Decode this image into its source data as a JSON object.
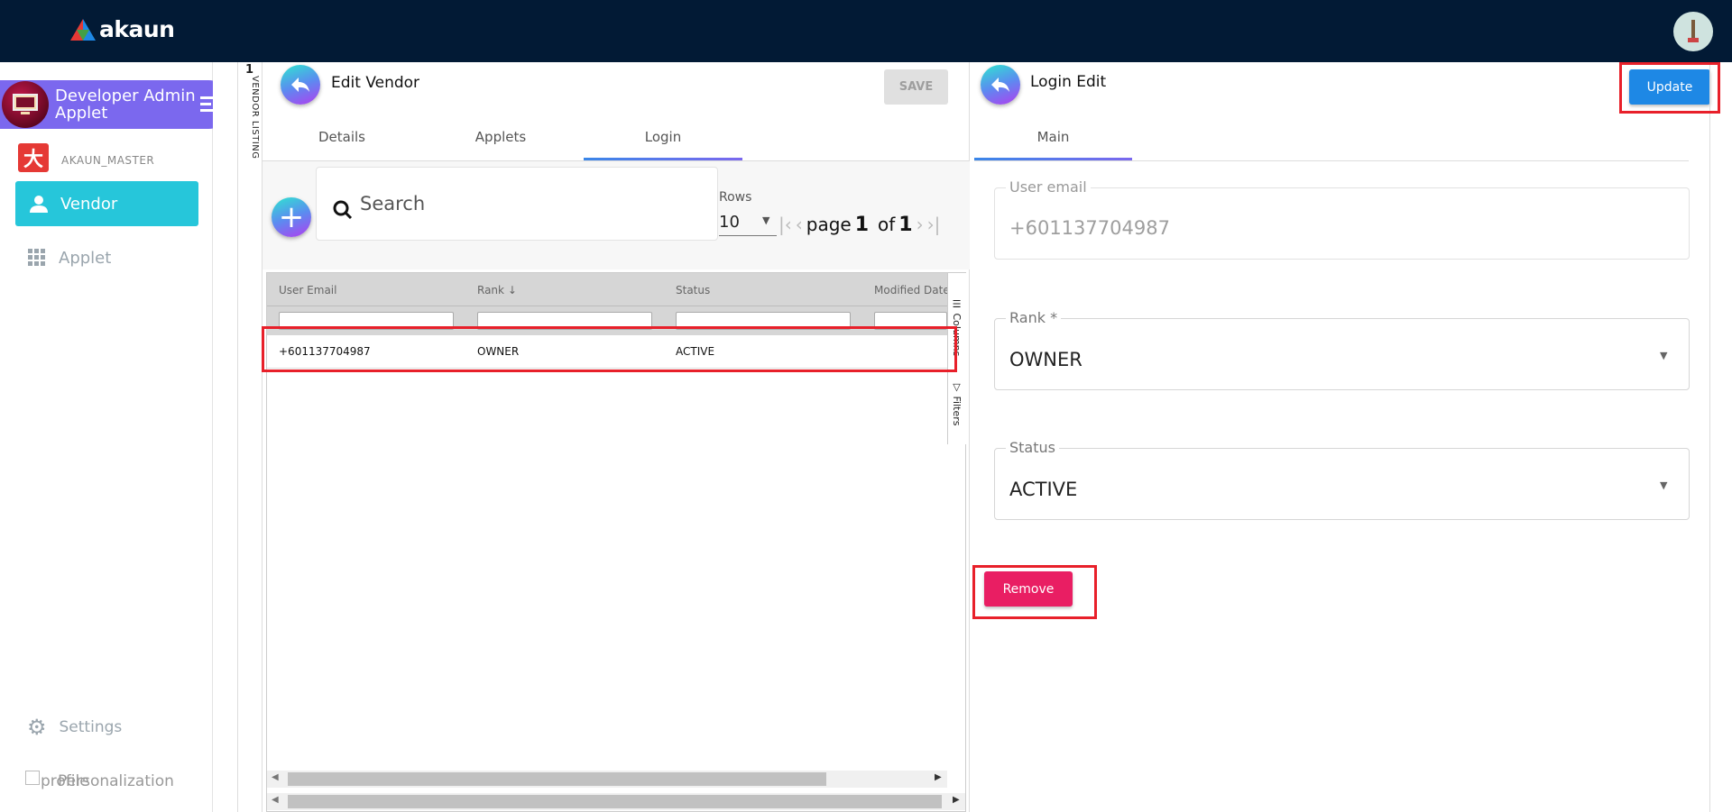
{
  "topbar": {
    "logo_text": "akaun",
    "avatar": "user-avatar"
  },
  "sidebar": {
    "applet_title_line1": "Developer Admin",
    "applet_title_line2": "Applet",
    "org": "AKAUN_MASTER",
    "items": [
      {
        "label": "Vendor",
        "icon": "person-icon",
        "active": true
      },
      {
        "label": "Applet",
        "icon": "grid-icon",
        "active": false
      }
    ],
    "settings": "Settings",
    "profile": "profile",
    "personalization": "Personalization",
    "active_color": "#26c6da",
    "header_color": "#7b68ee"
  },
  "listing_strip": {
    "count": "1",
    "label": "VENDOR LISTING"
  },
  "edit_vendor": {
    "title": "Edit Vendor",
    "save": "SAVE",
    "tabs": [
      "Details",
      "Applets",
      "Login"
    ],
    "active_tab": "Login",
    "search_placeholder": "Search",
    "rows_label": "Rows",
    "rows_value": "10",
    "page_word": "page",
    "page_current": "1",
    "of_word": "of",
    "page_total": "1",
    "grid": {
      "columns": [
        "User Email",
        "Rank",
        "Status",
        "Modified Date"
      ],
      "rows": [
        [
          "+601137704987",
          "OWNER",
          "ACTIVE",
          ""
        ]
      ],
      "side_columns": "Columns",
      "side_filters": "Filters"
    }
  },
  "login_edit": {
    "title": "Login Edit",
    "update": "Update",
    "tabs": [
      "Main"
    ],
    "user_email_label": "User email",
    "user_email_value": "+601137704987",
    "rank_label": "Rank *",
    "rank_value": "OWNER",
    "status_label": "Status",
    "status_value": "ACTIVE",
    "remove": "Remove",
    "update_color": "#1e88e5",
    "remove_color": "#e91e63"
  }
}
